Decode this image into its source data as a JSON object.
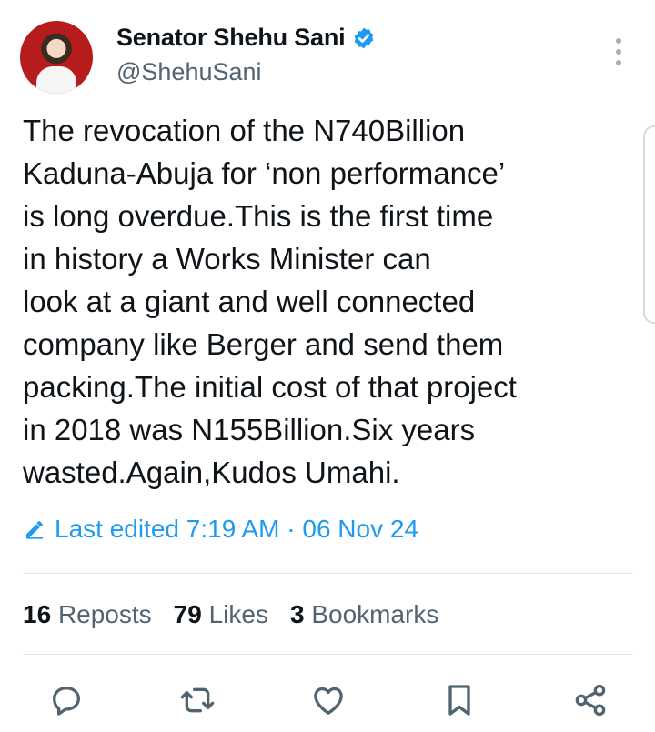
{
  "author": {
    "name": "Senator Shehu Sani",
    "handle": "@ShehuSani",
    "verified": true,
    "avatar": "avatar"
  },
  "tweet": {
    "text": "The revocation of the N740Billion\nKaduna-Abuja for ‘non performance’\nis long overdue.This is the first time\nin history a Works Minister can\nlook at a giant and well connected\ncompany like Berger and send them\npacking.The initial cost of that project\nin 2018 was N155Billion.Six years\nwasted.Again,Kudos Umahi."
  },
  "edit_info": {
    "label": "Last edited 7:19 AM · 06 Nov 24",
    "icon": "pencil-icon"
  },
  "stats": {
    "reposts_count": "16",
    "reposts_label": "Reposts",
    "likes_count": "79",
    "likes_label": "Likes",
    "bookmarks_count": "3",
    "bookmarks_label": "Bookmarks"
  },
  "actions": [
    {
      "icon": "reply-icon"
    },
    {
      "icon": "repost-icon"
    },
    {
      "icon": "like-icon"
    },
    {
      "icon": "bookmark-icon"
    },
    {
      "icon": "share-icon"
    }
  ],
  "colors": {
    "accent": "#1d9bf0",
    "text": "#0f1419",
    "secondary": "#536471",
    "icon": "#536471"
  }
}
